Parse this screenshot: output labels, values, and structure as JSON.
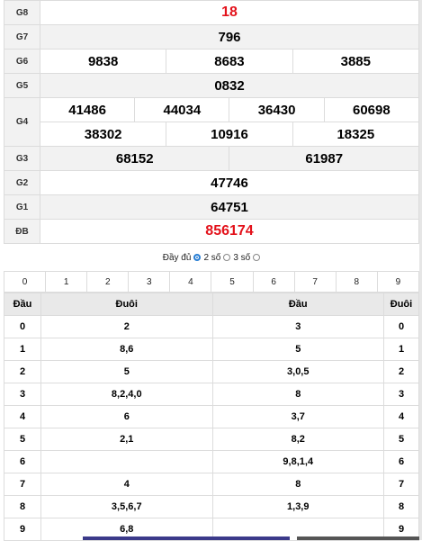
{
  "results": {
    "g8": {
      "label": "G8",
      "value": "18"
    },
    "g7": {
      "label": "G7",
      "value": "796"
    },
    "g6": {
      "label": "G6",
      "values": [
        "9838",
        "8683",
        "3885"
      ]
    },
    "g5": {
      "label": "G5",
      "value": "0832"
    },
    "g4": {
      "label": "G4",
      "row1": [
        "41486",
        "44034",
        "36430",
        "60698"
      ],
      "row2": [
        "38302",
        "10916",
        "18325"
      ]
    },
    "g3": {
      "label": "G3",
      "values": [
        "68152",
        "61987"
      ]
    },
    "g2": {
      "label": "G2",
      "value": "47746"
    },
    "g1": {
      "label": "G1",
      "value": "64751"
    },
    "db": {
      "label": "ĐB",
      "value": "856174"
    }
  },
  "options": {
    "full": "Đầy đủ",
    "two": "2 số",
    "three": "3 số",
    "selected": "2 số"
  },
  "digits": [
    "0",
    "1",
    "2",
    "3",
    "4",
    "5",
    "6",
    "7",
    "8",
    "9"
  ],
  "loto": {
    "headers": [
      "Đầu",
      "Đuôi",
      "Đầu",
      "Đuôi"
    ],
    "rows": [
      {
        "dau": "0",
        "duoi": "2",
        "dau2": "3",
        "duoi2": "0"
      },
      {
        "dau": "1",
        "duoi": "8,6",
        "dau2": "5",
        "duoi2": "1"
      },
      {
        "dau": "2",
        "duoi": "5",
        "dau2": "3,0,5",
        "duoi2": "2"
      },
      {
        "dau": "3",
        "duoi": "8,2,4,0",
        "dau2": "8",
        "duoi2": "3"
      },
      {
        "dau": "4",
        "duoi": "6",
        "dau2": "3,7",
        "duoi2": "4"
      },
      {
        "dau": "5",
        "duoi": "2,1",
        "dau2": "8,2",
        "duoi2": "5"
      },
      {
        "dau": "6",
        "duoi": "",
        "dau2": "9,8,1,4",
        "duoi2": "6"
      },
      {
        "dau": "7",
        "duoi": "4",
        "dau2": "8",
        "duoi2": "7"
      },
      {
        "dau": "8",
        "duoi": "3,5,6,7",
        "dau2": "1,3,9",
        "duoi2": "8"
      },
      {
        "dau": "9",
        "duoi": "6,8",
        "dau2": "",
        "duoi2": "9"
      }
    ]
  },
  "colors": {
    "special": "#e3121b",
    "radio": "#2a7fd4"
  }
}
